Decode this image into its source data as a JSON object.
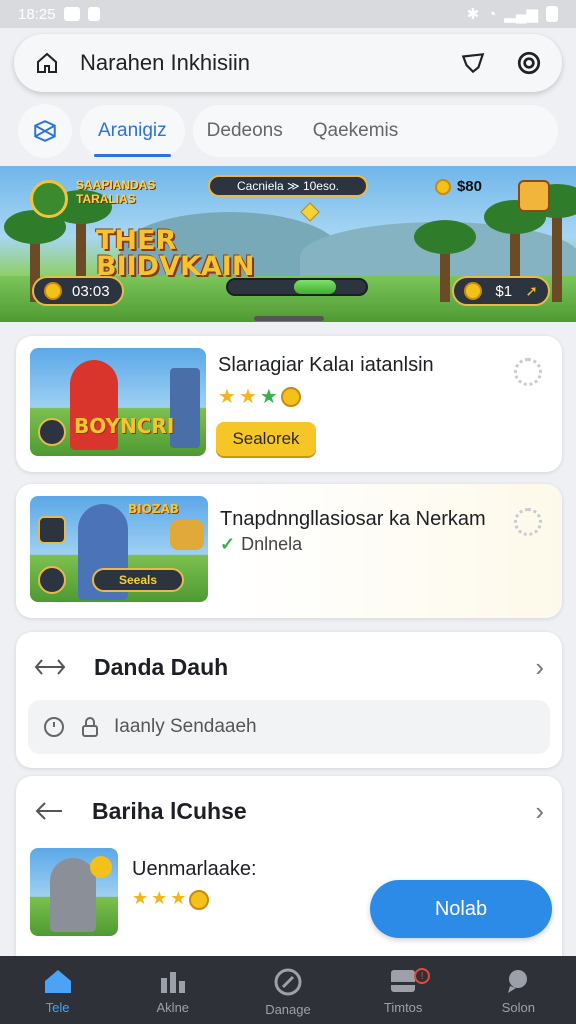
{
  "status_bar": {
    "time": "18:25"
  },
  "top_bar": {
    "title": "Narahen Inkhisiin"
  },
  "tabs": {
    "active": "Aranigiz",
    "items": [
      "Dedeons",
      "Qaekemis"
    ]
  },
  "banner": {
    "game_title": "THER BIIDVKAIN",
    "subtitle": "SAAPIANDAS TARALIAS",
    "score_pill": "Cacniela  ≫  10eso.",
    "coins_top": "$80",
    "left_pill": "03:03",
    "right_pill": "$1",
    "progress_percent": 48
  },
  "cards": [
    {
      "title": "Slarıagiar Kalaı iatanlsin",
      "thumb_label": "BOYNCRI",
      "button_label": "Sealorek",
      "rating": 3
    },
    {
      "title": "Tnapdnngllasiosar ka Nerkam",
      "thumb_label": "BIOZAB",
      "thumb_pill": "Seeals",
      "subtitle": "Dnlnela"
    }
  ],
  "section_one": {
    "label": "Danda Dauh",
    "search_placeholder": "Iaanly Sendaaeh"
  },
  "section_two": {
    "label": "Bariha lCuhse",
    "item_title": "Uenmarlaake:",
    "button_label": "Nolab"
  },
  "bottom_nav": [
    {
      "label": "Tele",
      "active": true
    },
    {
      "label": "Aklne"
    },
    {
      "label": "Danage"
    },
    {
      "label": "Timtos",
      "badge": "!"
    },
    {
      "label": "Solon"
    }
  ],
  "colors": {
    "accent": "#2a73d8",
    "button_blue": "#2d8be8",
    "button_yellow": "#f6c626",
    "nav_bg": "#2e3137"
  }
}
